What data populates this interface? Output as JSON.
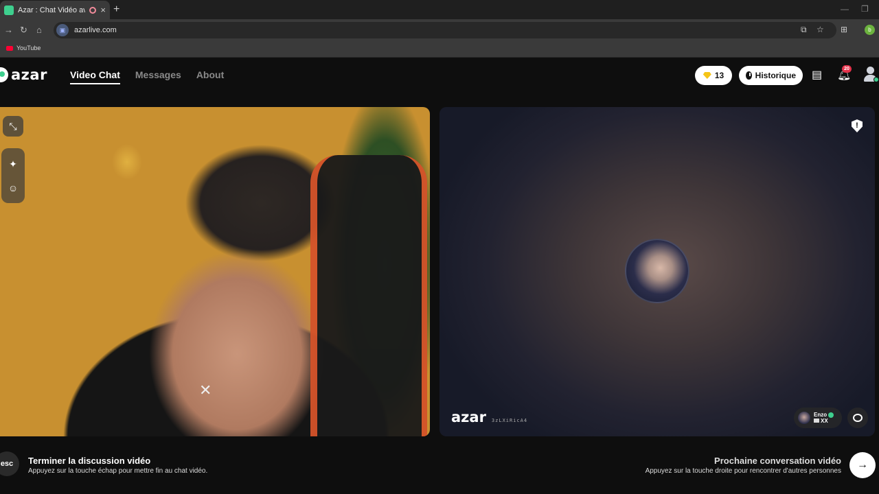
{
  "browser": {
    "tab_title": "Azar : Chat Vidéo avec de n",
    "new_tab": "+",
    "close": "×",
    "url": "azarlive.com",
    "bookmark_youtube": "YouTube",
    "profile_initial": "b"
  },
  "header": {
    "logo_text": "azar",
    "nav": [
      {
        "label": "Video Chat",
        "active": true
      },
      {
        "label": "Messages",
        "active": false
      },
      {
        "label": "About",
        "active": false
      }
    ],
    "gems": "13",
    "history_label": "Historique",
    "notifications_count": "20"
  },
  "remote": {
    "watermark": "azar",
    "user_id": "3zLXiRicA4",
    "partner_name": "Enzo",
    "partner_country": "XX"
  },
  "footer": {
    "esc_key": "esc",
    "end_title": "Terminer la discussion vidéo",
    "end_subtitle": "Appuyez sur la touche échap pour mettre fin au chat vidéo.",
    "next_title": "Prochaine conversation vidéo",
    "next_subtitle": "Appuyez sur la touche droite pour rencontrer d'autres personnes",
    "next_arrow": "→"
  },
  "colors": {
    "accent": "#3ecf8e",
    "notification": "#e5324b",
    "gem": "#f5c518"
  }
}
